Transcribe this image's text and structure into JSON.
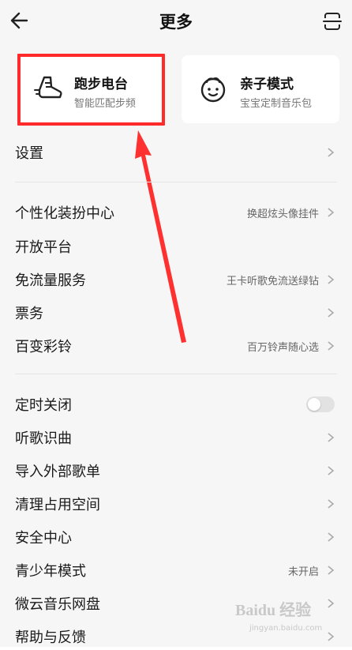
{
  "header": {
    "title": "更多",
    "back_icon": "back-arrow-icon",
    "scan_icon": "scan-icon"
  },
  "cards": {
    "running": {
      "title": "跑步电台",
      "subtitle": "智能匹配步频",
      "icon": "running-shoe-icon"
    },
    "kids": {
      "title": "亲子模式",
      "subtitle": "宝宝定制音乐包",
      "icon": "baby-face-icon"
    }
  },
  "rows": [
    {
      "label": "设置",
      "value": ""
    },
    {
      "label": "个性化装扮中心",
      "value": "换超炫头像挂件"
    },
    {
      "label": "开放平台",
      "value": ""
    },
    {
      "label": "免流量服务",
      "value": "王卡听歌免流送绿钻"
    },
    {
      "label": "票务",
      "value": ""
    },
    {
      "label": "百变彩铃",
      "value": "百万铃声随心选"
    },
    {
      "label": "定时关闭",
      "value": "",
      "toggle": false
    },
    {
      "label": "听歌识曲",
      "value": ""
    },
    {
      "label": "导入外部歌单",
      "value": ""
    },
    {
      "label": "清理占用空间",
      "value": ""
    },
    {
      "label": "安全中心",
      "value": ""
    },
    {
      "label": "青少年模式",
      "value": "未开启"
    },
    {
      "label": "微云音乐网盘",
      "value": ""
    },
    {
      "label": "帮助与反馈",
      "value": ""
    }
  ],
  "watermark": {
    "logo": "Baidu 经验",
    "url": "jingyan.baidu.com"
  },
  "colors": {
    "background": "#f6f6f6",
    "card": "#ffffff",
    "annotation": "#ff2a2a"
  }
}
